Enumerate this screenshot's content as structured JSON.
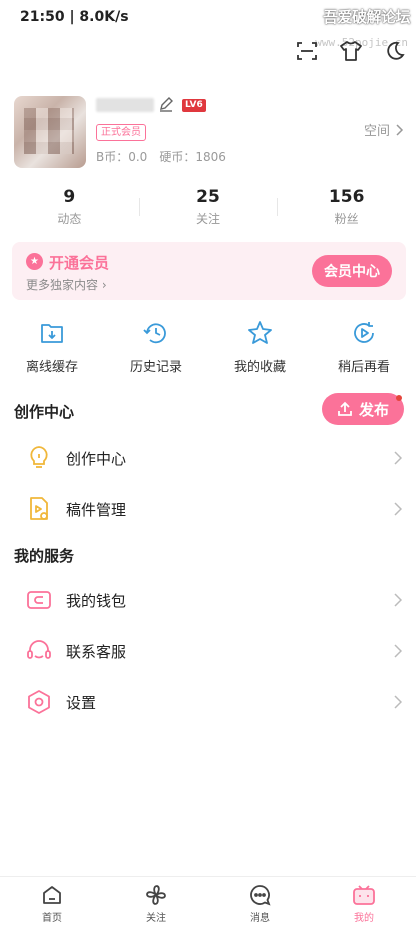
{
  "status_bar": {
    "text": "21:50 | 8.0K/s"
  },
  "watermark": {
    "text": "吾爱破解论坛",
    "url": "www.52pojie.cn"
  },
  "top_icons": [
    "scan-icon",
    "tshirt-icon",
    "moon-icon"
  ],
  "profile": {
    "level": "LV6",
    "member_badge": "正式会员",
    "b_coin": "B币：0.0",
    "coin": "硬币：1806",
    "space_link": "空间"
  },
  "stats": [
    {
      "value": "9",
      "label": "动态"
    },
    {
      "value": "25",
      "label": "关注"
    },
    {
      "value": "156",
      "label": "粉丝"
    }
  ],
  "vip": {
    "title": "开通会员",
    "subtitle": "更多独家内容",
    "button": "会员中心"
  },
  "quick_actions": [
    {
      "label": "离线缓存",
      "icon": "download-icon"
    },
    {
      "label": "历史记录",
      "icon": "history-icon"
    },
    {
      "label": "我的收藏",
      "icon": "star-icon"
    },
    {
      "label": "稍后再看",
      "icon": "watch-later-icon"
    }
  ],
  "creation": {
    "title": "创作中心",
    "publish_button": "发布",
    "items": [
      {
        "label": "创作中心",
        "icon": "lightbulb-icon"
      },
      {
        "label": "稿件管理",
        "icon": "manuscript-icon"
      }
    ]
  },
  "services": {
    "title": "我的服务",
    "items": [
      {
        "label": "我的钱包",
        "icon": "wallet-icon"
      },
      {
        "label": "联系客服",
        "icon": "headset-icon"
      },
      {
        "label": "设置",
        "icon": "settings-icon"
      }
    ]
  },
  "tabbar": [
    {
      "label": "首页",
      "icon": "home-icon"
    },
    {
      "label": "关注",
      "icon": "fan-icon"
    },
    {
      "label": "消息",
      "icon": "message-icon"
    },
    {
      "label": "我的",
      "icon": "tv-icon"
    }
  ],
  "colors": {
    "accent": "#fb7299",
    "level_badge": "#e0383e",
    "icon_blue": "#3a9ad9",
    "icon_yellow": "#f0b73a"
  }
}
